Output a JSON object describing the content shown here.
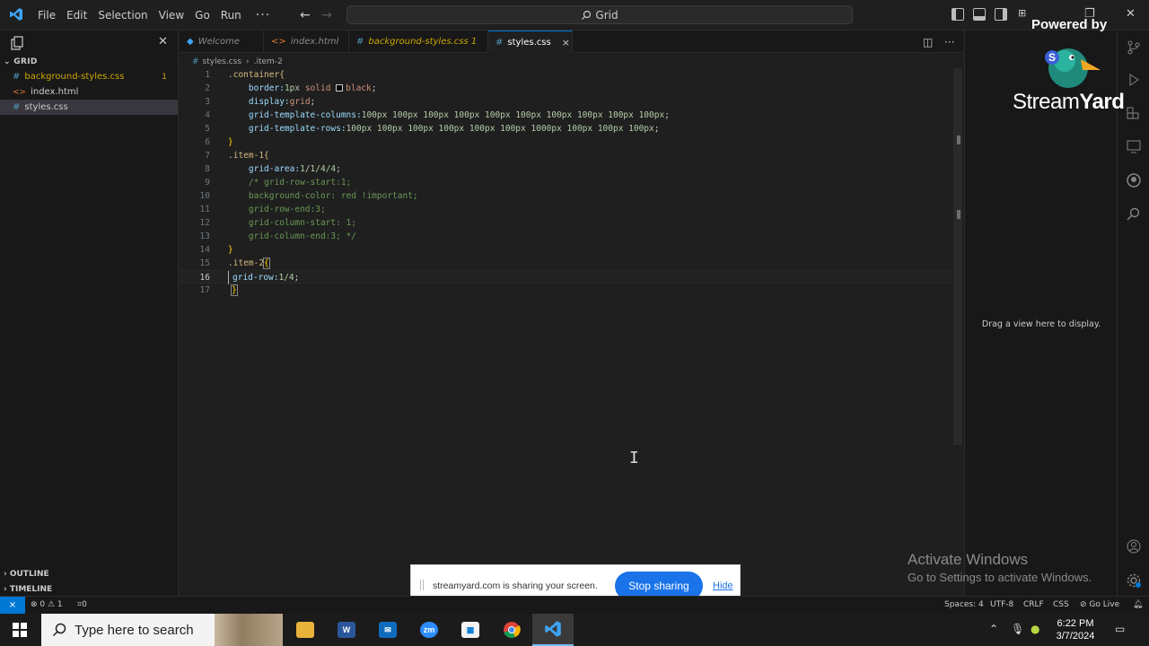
{
  "titlebar": {
    "menu": [
      "File",
      "Edit",
      "Selection",
      "View",
      "Go",
      "Run"
    ],
    "more": "···",
    "search": "Grid"
  },
  "sidebar": {
    "folder": "GRID",
    "files": [
      {
        "name": "background-styles.css",
        "type": "css",
        "badge": "1"
      },
      {
        "name": "index.html",
        "type": "html",
        "badge": ""
      },
      {
        "name": "styles.css",
        "type": "css",
        "badge": ""
      }
    ],
    "outline": "OUTLINE",
    "timeline": "TIMELINE"
  },
  "tabs": [
    {
      "label": "Welcome",
      "icon": "vscode-icon"
    },
    {
      "label": "index.html",
      "icon": "html-icon"
    },
    {
      "label": "background-styles.css 1",
      "icon": "css-icon"
    },
    {
      "label": "styles.css",
      "icon": "css-icon",
      "close": "×"
    }
  ],
  "breadcrumb": {
    "file": "styles.css",
    "symbol": ".item-2"
  },
  "editor": {
    "line_numbers": [
      "1",
      "2",
      "3",
      "4",
      "5",
      "6",
      "7",
      "8",
      "9",
      "10",
      "11",
      "12",
      "13",
      "14",
      "15",
      "16",
      "17"
    ],
    "l1_sel": ".container{",
    "l2_prop": "border:",
    "l2_num": "1px",
    "l2_val": " solid ",
    "l2_val2": "black",
    "l2_end": ";",
    "l3_prop": "display:",
    "l3_val": "grid",
    "l3_end": ";",
    "l4_prop": "grid-template-columns:",
    "l4_val": "100px 100px 100px 100px 100px 100px 100px 100px 100px 100px",
    "l4_end": ";",
    "l5_prop": "grid-template-rows:",
    "l5_val": "100px 100px 100px 100px 100px 100px 1000px 100px 100px 100px",
    "l5_end": ";",
    "l6": "}",
    "l7_sel": ".item-1{",
    "l8_prop": "grid-area:",
    "l8_val": "1/1/4/4",
    "l8_end": ";",
    "l9": "/* grid-row-start:1;",
    "l10": "background-color: red !important;",
    "l11": "grid-row-end:3;",
    "l12": "grid-column-start: 1;",
    "l13": "grid-column-end:3; */",
    "l14": "}",
    "l15_sel": ".item-2",
    "l15_brace": "{",
    "l16_prop": "grid-row:",
    "l16_val": "1/4",
    "l16_end": ";",
    "l17": "}"
  },
  "right_panel": {
    "message": "Drag a view here to display."
  },
  "overlay": {
    "powered_by": "Powered by",
    "brand_left": "Stream",
    "brand_right": "Yard"
  },
  "activate": {
    "title": "Activate Windows",
    "subtitle": "Go to Settings to activate Windows."
  },
  "sharebar": {
    "message": "streamyard.com is sharing your screen.",
    "stop": "Stop sharing",
    "hide": "Hide"
  },
  "statusbar": {
    "problems": "⊗ 0 ⚠ 1",
    "ports": "⌗0",
    "spaces": "Spaces: 4",
    "encoding": "UTF-8",
    "eol": "CRLF",
    "language": "CSS",
    "golive": "⊘ Go Live"
  },
  "taskbar": {
    "search_placeholder": "Type here to search",
    "time": "6:22 PM",
    "date": "3/7/2024"
  },
  "colors": {
    "accent": "#0078d4",
    "css_icon": "#519aba",
    "html_icon": "#e37933",
    "stop_button": "#1a73e8"
  }
}
